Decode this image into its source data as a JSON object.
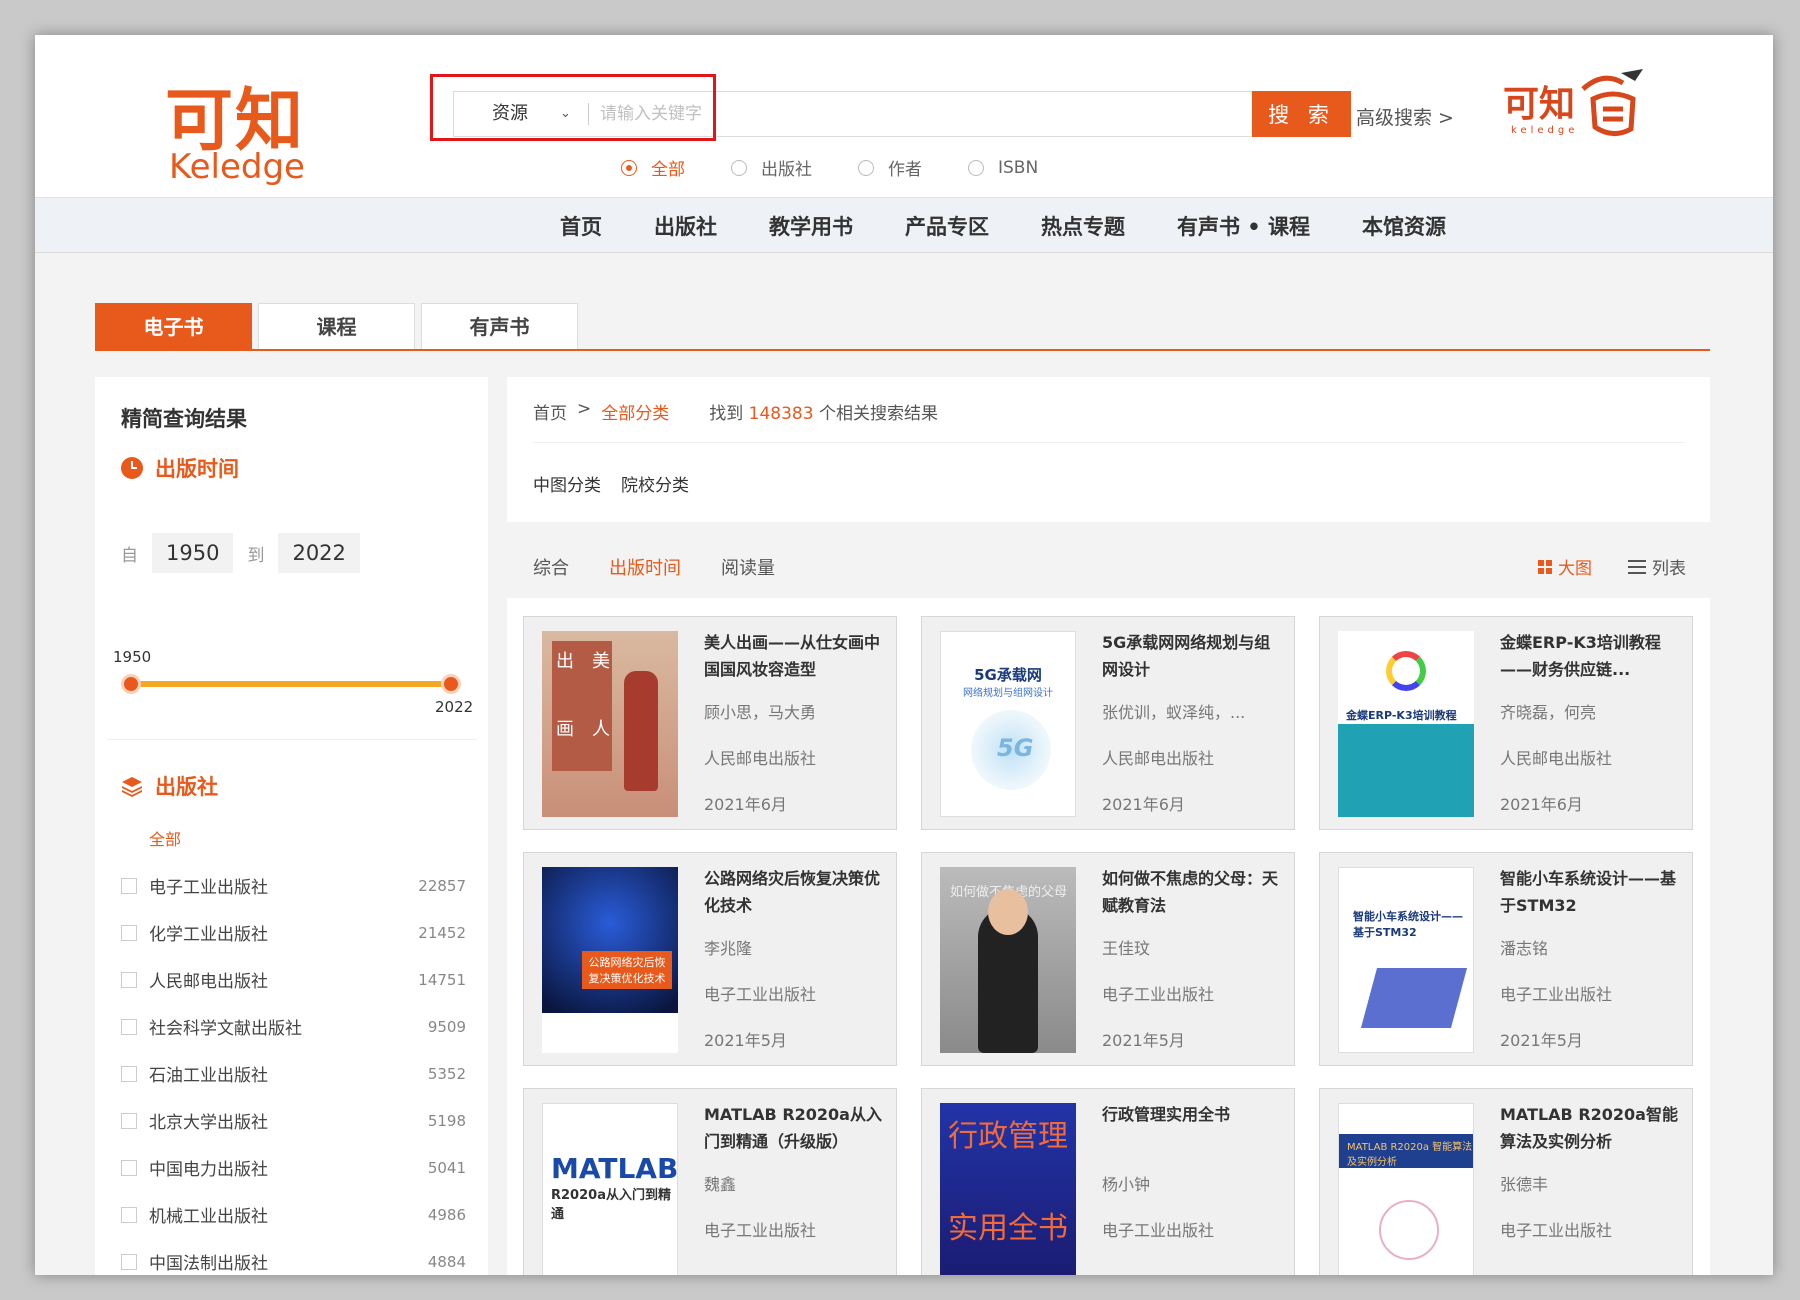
{
  "header": {
    "logo_cn": "可知",
    "logo_en": "Keledge",
    "search": {
      "type_label": "资源",
      "placeholder": "请输入关键字",
      "button_label": "搜 索"
    },
    "advanced_search": "高级搜索 >",
    "brand_right_cn": "可知",
    "brand_right_en": "keledge",
    "scopes": [
      "全部",
      "出版社",
      "作者",
      "ISBN"
    ]
  },
  "nav": [
    "首页",
    "出版社",
    "教学用书",
    "产品专区",
    "热点专题",
    "有声书 • 课程",
    "本馆资源"
  ],
  "type_tabs": [
    "电子书",
    "课程",
    "有声书"
  ],
  "sidebar": {
    "title": "精简查询结果",
    "year_section": {
      "title": "出版时间",
      "from_label": "自",
      "from": "1950",
      "to_label": "到",
      "to": "2022",
      "slider_min": "1950",
      "slider_max": "2022"
    },
    "publisher_section": {
      "title": "出版社",
      "all_label": "全部",
      "items": [
        {
          "name": "电子工业出版社",
          "count": "22857"
        },
        {
          "name": "化学工业出版社",
          "count": "21452"
        },
        {
          "name": "人民邮电出版社",
          "count": "14751"
        },
        {
          "name": "社会科学文献出版社",
          "count": "9509"
        },
        {
          "name": "石油工业出版社",
          "count": "5352"
        },
        {
          "name": "北京大学出版社",
          "count": "5198"
        },
        {
          "name": "中国电力出版社",
          "count": "5041"
        },
        {
          "name": "机械工业出版社",
          "count": "4986"
        },
        {
          "name": "中国法制出版社",
          "count": "4884"
        }
      ]
    }
  },
  "breadcrumb": {
    "home": "首页",
    "sep": ">",
    "current": "全部分类",
    "found_prefix": "找到",
    "count": "148383",
    "found_suffix": "个相关搜索结果"
  },
  "classification_tabs": [
    "中图分类",
    "院校分类"
  ],
  "sort": {
    "options": [
      "综合",
      "出版时间",
      "阅读量"
    ],
    "active": "出版时间",
    "views": [
      "大图",
      "列表"
    ]
  },
  "books": [
    {
      "title": "美人出画——从仕女画中国国风妆容造型",
      "author": "顾小思，马大勇",
      "publisher": "人民邮电出版社",
      "date": "2021年6月"
    },
    {
      "title": "5G承载网网络规划与组网设计",
      "author": "张优训，蚁泽纯，...",
      "publisher": "人民邮电出版社",
      "date": "2021年6月"
    },
    {
      "title": "金蝶ERP-K3培训教程——财务供应链...",
      "author": "齐晓磊，何亮",
      "publisher": "人民邮电出版社",
      "date": "2021年6月"
    },
    {
      "title": "公路网络灾后恢复决策优化技术",
      "author": "李兆隆",
      "publisher": "电子工业出版社",
      "date": "2021年5月"
    },
    {
      "title": "如何做不焦虑的父母：天赋教育法",
      "author": "王佳玟",
      "publisher": "电子工业出版社",
      "date": "2021年5月"
    },
    {
      "title": "智能小车系统设计——基于STM32",
      "author": "潘志铭",
      "publisher": "电子工业出版社",
      "date": "2021年5月"
    },
    {
      "title": "MATLAB R2020a从入门到精通（升级版）",
      "author": "魏鑫",
      "publisher": "电子工业出版社",
      "date": ""
    },
    {
      "title": "行政管理实用全书",
      "author": "杨小钟",
      "publisher": "电子工业出版社",
      "date": ""
    },
    {
      "title": "MATLAB R2020a智能算法及实例分析",
      "author": "张德丰",
      "publisher": "电子工业出版社",
      "date": ""
    }
  ],
  "covers": {
    "c1_a": "出",
    "c1_b": "美",
    "c1_c": "画",
    "c1_d": "人",
    "c2_title": "5G承载网",
    "c2_sub": "网络规划与组网设计",
    "c2_logo": "5G",
    "c3_title": "金蝶ERP-K3培训教程",
    "c4_title": "公路网络灾后恢复决策优化技术",
    "c5_title": "如何做不焦虑的父母",
    "c6_title": "智能小车系统设计——基于STM32",
    "c7_title": "MATLAB",
    "c7_sub": "R2020a从入门到精通",
    "c8_a": "行政管理",
    "c8_b": "实用全书",
    "c9_title": "MATLAB R2020a 智能算法及实例分析"
  },
  "colors": {
    "accent": "#e85a1c",
    "highlight_box": "#e0161b"
  }
}
